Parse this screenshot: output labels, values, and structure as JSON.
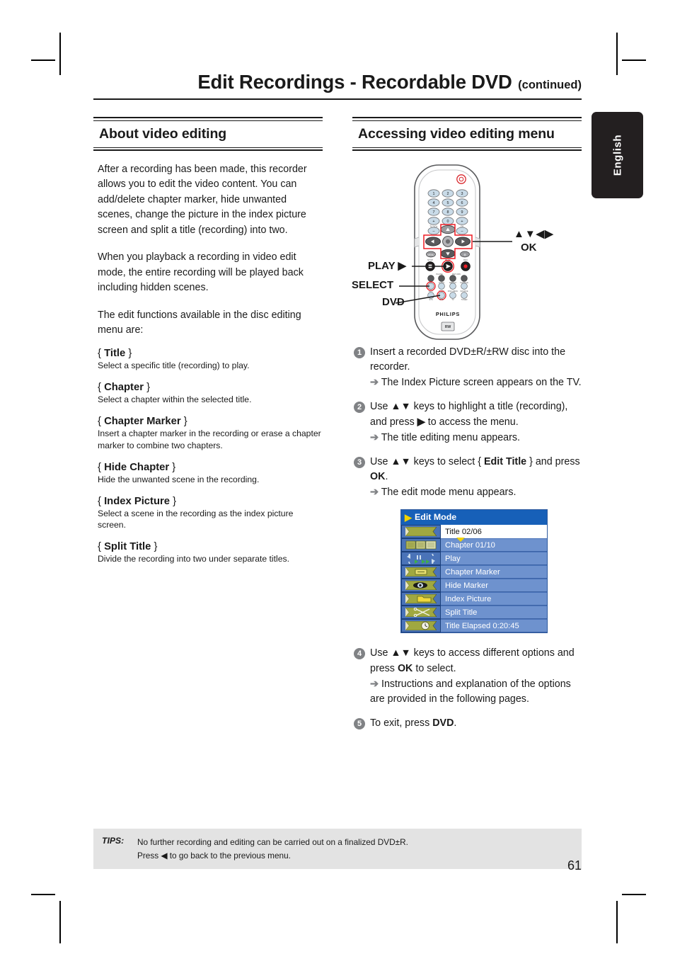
{
  "document": {
    "title": "Edit Recordings - Recordable DVD",
    "title_continued": "(continued)",
    "language_tab": "English",
    "page_number": "61"
  },
  "left_column": {
    "heading": "About video editing",
    "paragraphs": [
      "After a recording has been made, this recorder allows you to edit the video content. You can add/delete chapter marker, hide unwanted scenes, change the picture in the index picture screen and split a title (recording) into two.",
      "When you playback a recording in video edit mode, the entire recording will be played back including hidden scenes.",
      "The edit functions available in the disc editing menu are:"
    ],
    "definitions": [
      {
        "term_open": "{ ",
        "term": "Title",
        "term_close": " }",
        "desc": "Select a specific title (recording) to play."
      },
      {
        "term_open": "{ ",
        "term": "Chapter",
        "term_close": " }",
        "desc": "Select a chapter within the selected title."
      },
      {
        "term_open": "{ ",
        "term": "Chapter Marker",
        "term_close": " }",
        "desc": "Insert a chapter marker in the recording or erase a chapter marker to combine two chapters."
      },
      {
        "term_open": "{ ",
        "term": "Hide Chapter",
        "term_close": " }",
        "desc": "Hide the unwanted scene in the recording."
      },
      {
        "term_open": "{ ",
        "term": "Index Picture",
        "term_close": " }",
        "desc": "Select a scene in the recording as the index picture screen."
      },
      {
        "term_open": "{ ",
        "term": "Split Title",
        "term_close": " }",
        "desc": "Divide the recording into two under separate titles."
      }
    ]
  },
  "right_column": {
    "heading": "Accessing video editing menu",
    "remote": {
      "brand": "PHILIPS",
      "callouts": {
        "navigation": "▲▼◀▶",
        "ok": "OK",
        "play": "PLAY ▶",
        "select": "SELECT",
        "dvd": "DVD"
      },
      "keypad": [
        "1",
        "2",
        "3",
        "4",
        "5",
        "6",
        "7",
        "8",
        "9",
        "0"
      ],
      "tv_vol_label": "TV VOL",
      "ch_label": "CH"
    },
    "steps": [
      {
        "num": "1",
        "text": "Insert a recorded DVD±R/±RW disc into the recorder.",
        "result": "The Index Picture screen appears on the TV."
      },
      {
        "num": "2",
        "text_pre": "Use ▲▼ keys to highlight a title (recording), and press ",
        "text_arrow": "▶",
        "text_post": " to access the menu.",
        "result": "The title editing menu appears."
      },
      {
        "num": "3",
        "text_pre": "Use ▲▼ keys to select { ",
        "bold1": "Edit Title",
        "text_mid": " } and press ",
        "bold2": "OK",
        "text_post": ".",
        "result": "The edit mode menu appears."
      },
      {
        "num": "4",
        "text_pre": "Use ▲▼ keys to access different options and press ",
        "bold1": "OK",
        "text_post": " to select.",
        "result": "Instructions and explanation of the options are provided in the following pages."
      },
      {
        "num": "5",
        "text_pre": "To exit, press ",
        "bold1": "DVD",
        "text_post": "."
      }
    ],
    "osd": {
      "header": "Edit Mode",
      "header_chevron": "▶",
      "rows": [
        {
          "label": "Title 02/06",
          "icon": "banner-plain-icon",
          "selected": true
        },
        {
          "label": "Chapter 01/10",
          "icon": "book-pages-icon",
          "selected": false
        },
        {
          "label": "Play",
          "icon": "play-shuttle-icon",
          "selected": false
        },
        {
          "label": "Chapter Marker",
          "icon": "banner-marker-icon",
          "selected": false
        },
        {
          "label": "Hide Marker",
          "icon": "banner-eye-icon",
          "selected": false
        },
        {
          "label": "Index Picture",
          "icon": "banner-folder-icon",
          "selected": false
        },
        {
          "label": "Split Title",
          "icon": "banner-scissors-icon",
          "selected": false
        },
        {
          "label": "Title Elapsed 0:20:45",
          "icon": "banner-clock-icon",
          "selected": false
        }
      ]
    }
  },
  "tips": {
    "label": "TIPS:",
    "lines": [
      "No further recording and editing can be carried out on a finalized DVD±R.",
      "Press ◀ to go back to the previous menu."
    ]
  },
  "colors": {
    "osd_header_blue": "#1760b8",
    "osd_body_blue": "#4a73b8",
    "osd_row_blue": "#6e92ce",
    "osd_accent_yellow": "#f2d300",
    "tips_gray": "#e3e3e3",
    "step_num_gray": "#808285",
    "tab_black": "#231f20"
  }
}
